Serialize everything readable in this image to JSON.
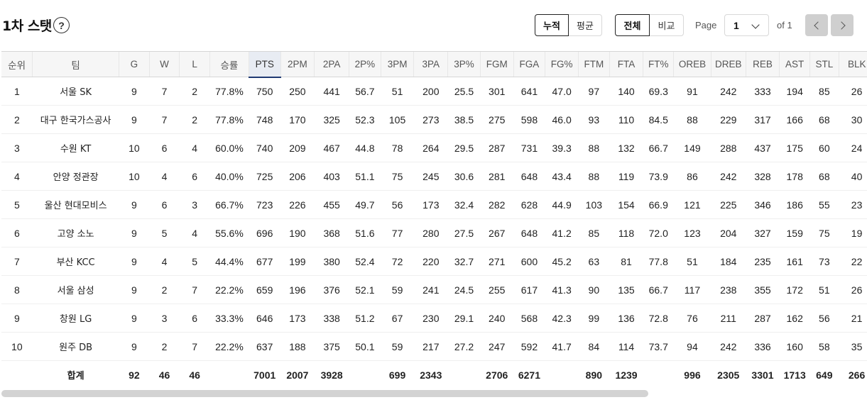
{
  "header": {
    "title": "1차 스탯",
    "help_symbol": "?",
    "mode_toggle": [
      "누적",
      "평균"
    ],
    "scope_toggle": [
      "전체",
      "비교"
    ],
    "page_label": "Page",
    "page_value": "1",
    "page_of": "of 1"
  },
  "table": {
    "columns": [
      "순위",
      "팀",
      "G",
      "W",
      "L",
      "승률",
      "PTS",
      "2PM",
      "2PA",
      "2P%",
      "3PM",
      "3PA",
      "3P%",
      "FGM",
      "FGA",
      "FG%",
      "FTM",
      "FTA",
      "FT%",
      "OREB",
      "DREB",
      "REB",
      "AST",
      "STL",
      "BLK"
    ],
    "sorted_column": "PTS",
    "rows": [
      [
        "1",
        "서울 SK",
        "9",
        "7",
        "2",
        "77.8%",
        "750",
        "250",
        "441",
        "56.7",
        "51",
        "200",
        "25.5",
        "301",
        "641",
        "47.0",
        "97",
        "140",
        "69.3",
        "91",
        "242",
        "333",
        "194",
        "85",
        "26"
      ],
      [
        "2",
        "대구 한국가스공사",
        "9",
        "7",
        "2",
        "77.8%",
        "748",
        "170",
        "325",
        "52.3",
        "105",
        "273",
        "38.5",
        "275",
        "598",
        "46.0",
        "93",
        "110",
        "84.5",
        "88",
        "229",
        "317",
        "166",
        "68",
        "30"
      ],
      [
        "3",
        "수원 KT",
        "10",
        "6",
        "4",
        "60.0%",
        "740",
        "209",
        "467",
        "44.8",
        "78",
        "264",
        "29.5",
        "287",
        "731",
        "39.3",
        "88",
        "132",
        "66.7",
        "149",
        "288",
        "437",
        "175",
        "60",
        "24"
      ],
      [
        "4",
        "안양 정관장",
        "10",
        "4",
        "6",
        "40.0%",
        "725",
        "206",
        "403",
        "51.1",
        "75",
        "245",
        "30.6",
        "281",
        "648",
        "43.4",
        "88",
        "119",
        "73.9",
        "86",
        "242",
        "328",
        "178",
        "68",
        "40"
      ],
      [
        "5",
        "울산 현대모비스",
        "9",
        "6",
        "3",
        "66.7%",
        "723",
        "226",
        "455",
        "49.7",
        "56",
        "173",
        "32.4",
        "282",
        "628",
        "44.9",
        "103",
        "154",
        "66.9",
        "121",
        "225",
        "346",
        "186",
        "55",
        "23"
      ],
      [
        "6",
        "고양 소노",
        "9",
        "5",
        "4",
        "55.6%",
        "696",
        "190",
        "368",
        "51.6",
        "77",
        "280",
        "27.5",
        "267",
        "648",
        "41.2",
        "85",
        "118",
        "72.0",
        "123",
        "204",
        "327",
        "159",
        "75",
        "19"
      ],
      [
        "7",
        "부산 KCC",
        "9",
        "4",
        "5",
        "44.4%",
        "677",
        "199",
        "380",
        "52.4",
        "72",
        "220",
        "32.7",
        "271",
        "600",
        "45.2",
        "63",
        "81",
        "77.8",
        "51",
        "184",
        "235",
        "161",
        "73",
        "22"
      ],
      [
        "8",
        "서울 삼성",
        "9",
        "2",
        "7",
        "22.2%",
        "659",
        "196",
        "376",
        "52.1",
        "59",
        "241",
        "24.5",
        "255",
        "617",
        "41.3",
        "90",
        "135",
        "66.7",
        "117",
        "238",
        "355",
        "172",
        "51",
        "26"
      ],
      [
        "9",
        "창원 LG",
        "9",
        "3",
        "6",
        "33.3%",
        "646",
        "173",
        "338",
        "51.2",
        "67",
        "230",
        "29.1",
        "240",
        "568",
        "42.3",
        "99",
        "136",
        "72.8",
        "76",
        "211",
        "287",
        "162",
        "56",
        "21"
      ],
      [
        "10",
        "원주 DB",
        "9",
        "2",
        "7",
        "22.2%",
        "637",
        "188",
        "375",
        "50.1",
        "59",
        "217",
        "27.2",
        "247",
        "592",
        "41.7",
        "84",
        "114",
        "73.7",
        "94",
        "242",
        "336",
        "160",
        "58",
        "35"
      ]
    ],
    "totals": [
      "",
      "합계",
      "92",
      "46",
      "46",
      "",
      "7001",
      "2007",
      "3928",
      "",
      "699",
      "2343",
      "",
      "2706",
      "6271",
      "",
      "890",
      "1239",
      "",
      "996",
      "2305",
      "3301",
      "1713",
      "649",
      "266"
    ]
  },
  "colors": {
    "sorted_header_bg": "#e8ecf3",
    "sorted_header_underline": "#1f3a73",
    "nav_button_bg": "#cfcfcf"
  }
}
